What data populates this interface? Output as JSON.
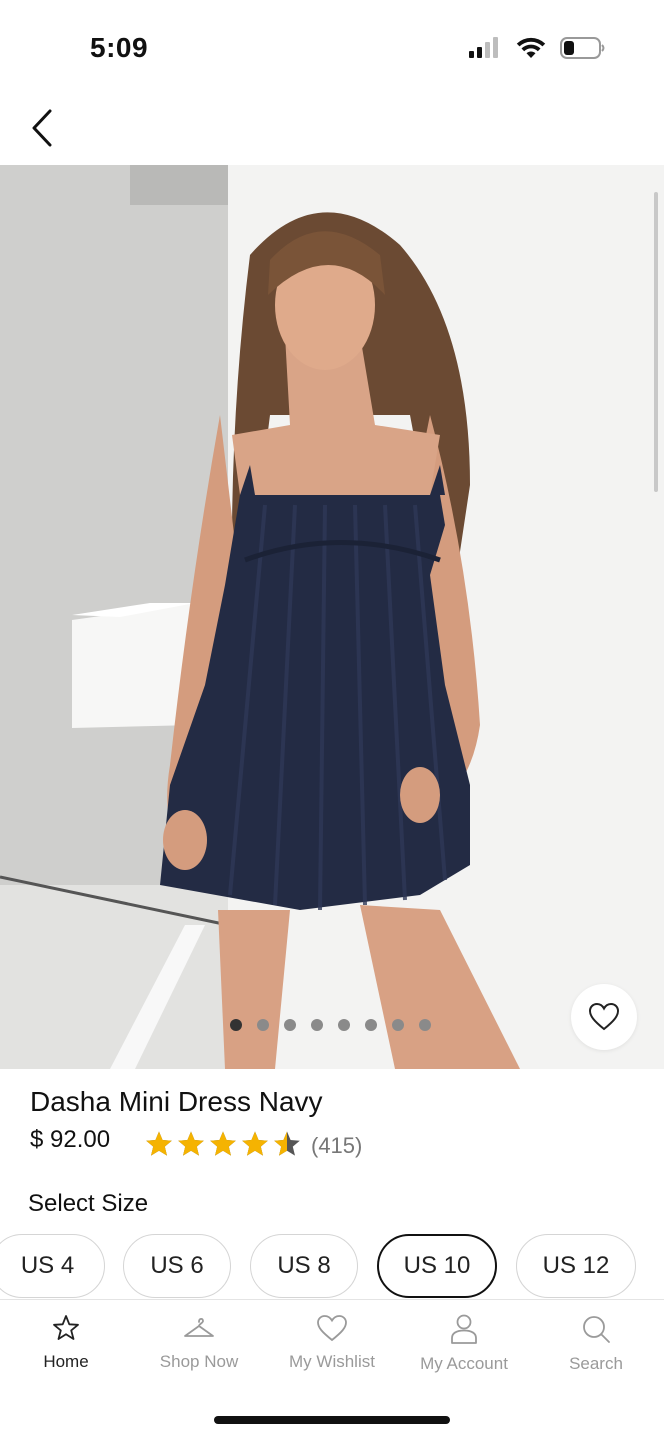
{
  "status_bar": {
    "time": "5:09"
  },
  "product": {
    "title": "Dasha Mini Dress Navy",
    "price": "$ 92.00",
    "rating": 4.5,
    "rating_max": 5,
    "review_count": "(415)",
    "image_count": 8,
    "active_image": 1
  },
  "size_selector": {
    "label": "Select Size",
    "sizes": [
      "US 4",
      "US 6",
      "US 8",
      "US 10",
      "US 12"
    ],
    "selected": "US 10"
  },
  "tab_bar": {
    "items": [
      {
        "label": "Home",
        "icon": "star-icon",
        "active": true
      },
      {
        "label": "Shop Now",
        "icon": "hanger-icon",
        "active": false
      },
      {
        "label": "My Wishlist",
        "icon": "heart-icon",
        "active": false
      },
      {
        "label": "My Account",
        "icon": "person-icon",
        "active": false
      },
      {
        "label": "Search",
        "icon": "search-icon",
        "active": false
      }
    ]
  },
  "colors": {
    "star": "#F5B301",
    "dress": "#232b44",
    "text": "#111111",
    "muted": "#9a9a9a"
  }
}
